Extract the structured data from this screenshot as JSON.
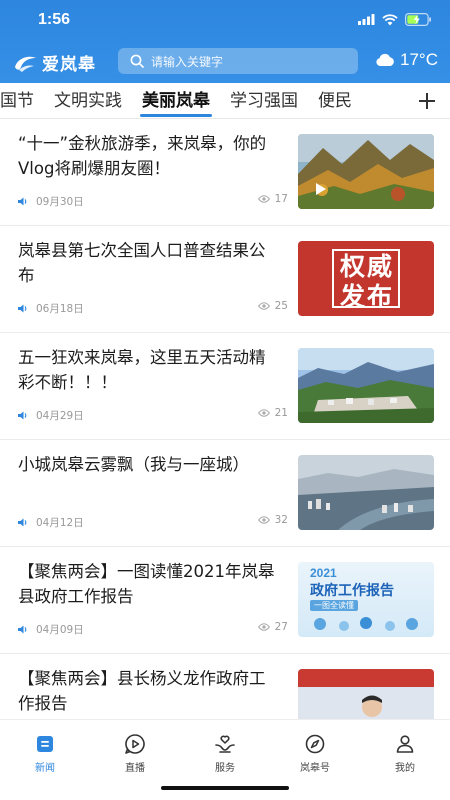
{
  "status_bar": {
    "time": "1:56"
  },
  "header": {
    "app_name": "爱岚皋",
    "search_placeholder": "请输入关键字",
    "weather_temp": "17°C"
  },
  "tabs": {
    "items": [
      "国节",
      "文明实践",
      "美丽岚皋",
      "学习强国",
      "便民"
    ],
    "active": "美丽岚皋"
  },
  "news": [
    {
      "title": "“十一”金秋旅游季，来岚皋，你的Vlog将刷爆朋友圈！",
      "date": "09月30日",
      "views": "17"
    },
    {
      "title": "岚皋县第七次全国人口普查结果公布",
      "date": "06月18日",
      "views": "25",
      "thumb_text_1": "权威",
      "thumb_text_2": "发布"
    },
    {
      "title": "五一狂欢来岚皋，这里五天活动精彩不断！！！",
      "date": "04月29日",
      "views": "21"
    },
    {
      "title": "小城岚皋云雾飘（我与一座城）",
      "date": "04月12日",
      "views": "32"
    },
    {
      "title": "【聚焦两会】一图读懂2021年岚皋县政府工作报告",
      "date": "04月09日",
      "views": "27",
      "thumb_year": "2021",
      "thumb_title": "政府工作报告",
      "thumb_sub": "一图全读懂"
    },
    {
      "title": "【聚焦两会】县长杨义龙作政府工作报告",
      "date": "",
      "views": ""
    }
  ],
  "bottom_nav": [
    {
      "label": "新闻",
      "icon": "news-icon",
      "active": true
    },
    {
      "label": "直播",
      "icon": "play-icon",
      "active": false
    },
    {
      "label": "服务",
      "icon": "heart-hand-icon",
      "active": false
    },
    {
      "label": "岚皋号",
      "icon": "compass-icon",
      "active": false
    },
    {
      "label": "我的",
      "icon": "person-icon",
      "active": false
    }
  ],
  "colors": {
    "brand": "#2e86de",
    "thumb_red": "#c2362e"
  }
}
